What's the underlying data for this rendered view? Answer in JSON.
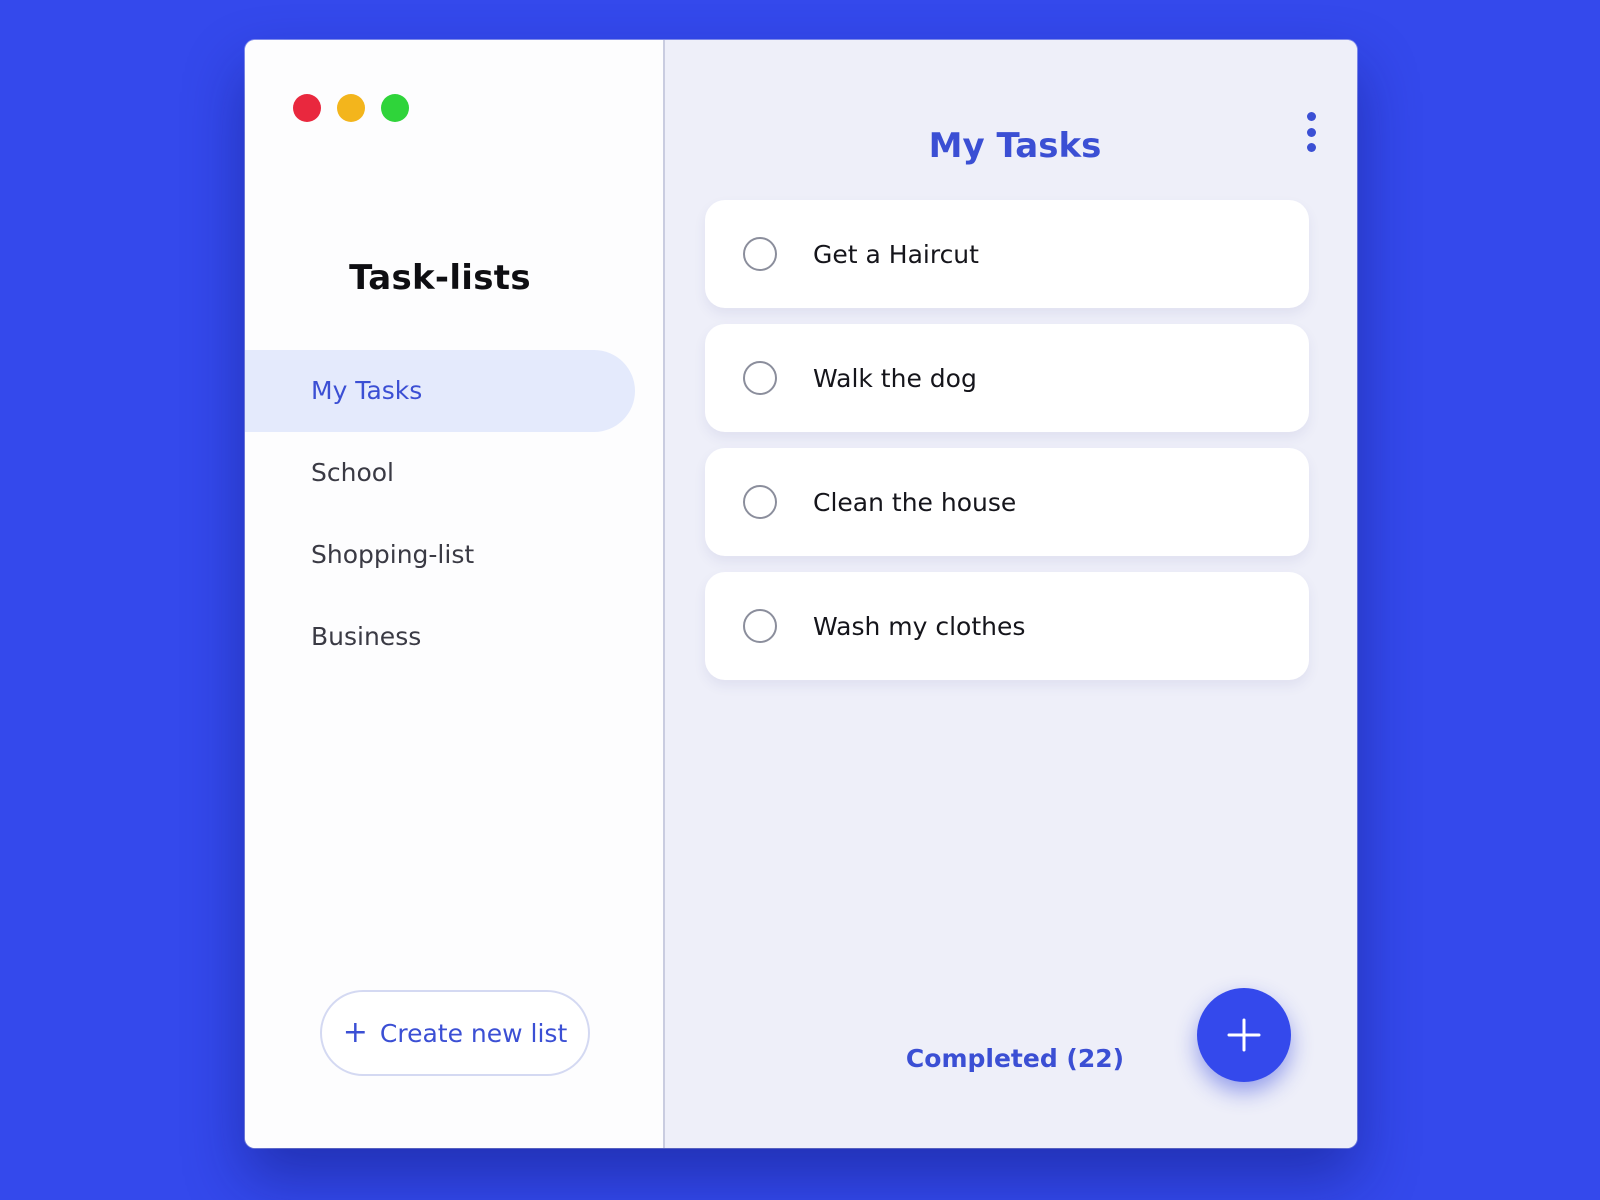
{
  "colors": {
    "background": "#3449ec",
    "accent": "#3b4fd4",
    "close": "#e9283e",
    "minimize": "#f3b51c",
    "maximize": "#2fd43a"
  },
  "window_controls": {
    "close_icon": "red-close-dot",
    "minimize_icon": "yellow-minimize-dot",
    "maximize_icon": "green-maximize-dot"
  },
  "sidebar": {
    "title": "Task-lists",
    "items": [
      {
        "label": "My Tasks",
        "active": true
      },
      {
        "label": "School",
        "active": false
      },
      {
        "label": "Shopping-list",
        "active": false
      },
      {
        "label": "Business",
        "active": false
      }
    ],
    "create_button": {
      "icon": "+",
      "label": "Create new list"
    }
  },
  "main": {
    "title": "My Tasks",
    "menu_icon": "more-vertical-icon",
    "tasks": [
      {
        "label": "Get a Haircut",
        "done": false
      },
      {
        "label": "Walk the dog",
        "done": false
      },
      {
        "label": "Clean the house",
        "done": false
      },
      {
        "label": "Wash my clothes",
        "done": false
      }
    ],
    "completed_label": "Completed (22)",
    "fab_icon": "plus-icon"
  }
}
